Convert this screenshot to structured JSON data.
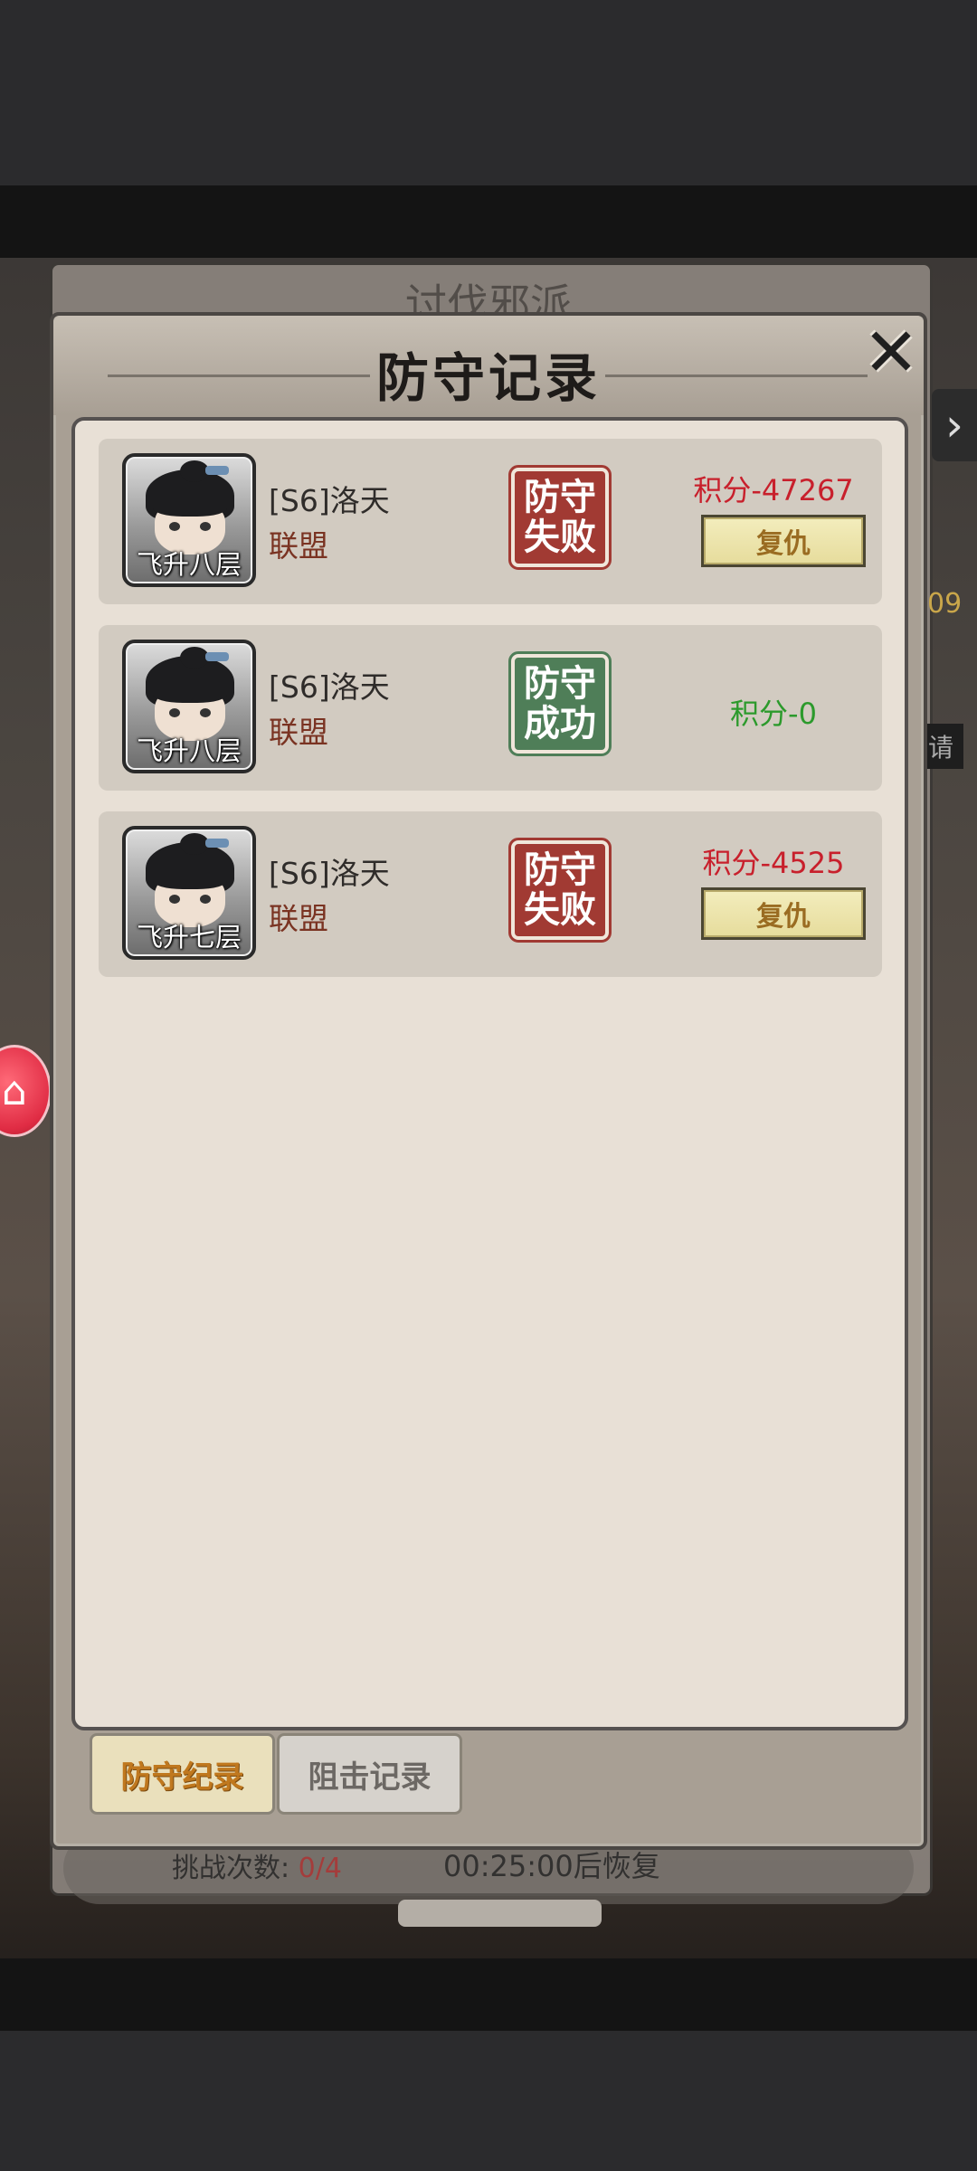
{
  "background": {
    "title": "讨伐邪派",
    "side_text": "09",
    "side_button": "请",
    "bottom_label": "挑战次数:",
    "bottom_count": "0/4",
    "bottom_time": "00:25:00后恢复"
  },
  "dialog": {
    "title": "防守记录",
    "close_icon": "close-icon"
  },
  "records": [
    {
      "avatar_label": "飞升八层",
      "name": "[S6]洛天",
      "guild": "联盟",
      "result": [
        "防守",
        "失败"
      ],
      "result_type": "fail",
      "score": "积分-47267",
      "revenge_label": "复仇"
    },
    {
      "avatar_label": "飞升八层",
      "name": "[S6]洛天",
      "guild": "联盟",
      "result": [
        "防守",
        "成功"
      ],
      "result_type": "success",
      "score": "积分-0"
    },
    {
      "avatar_label": "飞升七层",
      "name": "[S6]洛天",
      "guild": "联盟",
      "result": [
        "防守",
        "失败"
      ],
      "result_type": "fail",
      "score": "积分-4525",
      "revenge_label": "复仇"
    }
  ],
  "tabs": [
    {
      "label": "防守纪录",
      "active": true
    },
    {
      "label": "阻击记录",
      "active": false
    }
  ],
  "colors": {
    "fail_stamp": "#a13a33",
    "success_stamp": "#4f7e58",
    "negative_score": "#c8202c",
    "positive_score": "#2c9a2c",
    "guild_text": "#7a3322"
  }
}
